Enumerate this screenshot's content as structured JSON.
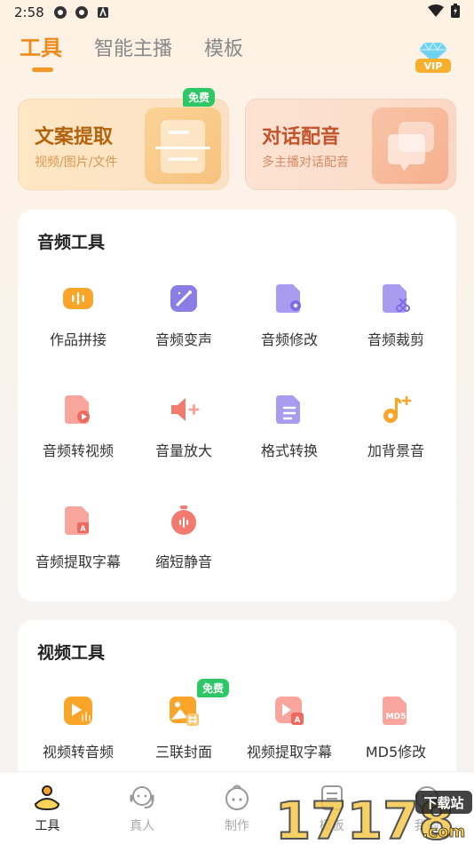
{
  "status_bar": {
    "time": "2:58"
  },
  "top_tabs": [
    {
      "label": "工具",
      "active": true
    },
    {
      "label": "智能主播",
      "active": false
    },
    {
      "label": "模板",
      "active": false
    }
  ],
  "vip_label": "VIP",
  "feature_cards": [
    {
      "title": "文案提取",
      "subtitle": "视频/图片/文件",
      "tag": "免费"
    },
    {
      "title": "对话配音",
      "subtitle": "多主播对话配音"
    }
  ],
  "audio_tools": {
    "title": "音频工具",
    "items": [
      {
        "label": "作品拼接",
        "icon": "waveform-icon",
        "color": "#f8a52a"
      },
      {
        "label": "音频变声",
        "icon": "magic-wand-icon",
        "color": "#8c7de6"
      },
      {
        "label": "音频修改",
        "icon": "file-gear-icon",
        "color": "#8c7de6"
      },
      {
        "label": "音频裁剪",
        "icon": "file-scissors-icon",
        "color": "#8c7de6"
      },
      {
        "label": "音频转视频",
        "icon": "file-play-icon",
        "color": "#f27a6f"
      },
      {
        "label": "音量放大",
        "icon": "speaker-plus-icon",
        "color": "#f27a6f"
      },
      {
        "label": "格式转换",
        "icon": "file-convert-icon",
        "color": "#8c7de6"
      },
      {
        "label": "加背景音",
        "icon": "music-note-plus-icon",
        "color": "#f8a52a"
      },
      {
        "label": "音频提取字幕",
        "icon": "file-subtitle-icon",
        "color": "#f27a6f"
      },
      {
        "label": "缩短静音",
        "icon": "stopwatch-icon",
        "color": "#f27a6f"
      }
    ]
  },
  "video_tools": {
    "title": "视频工具",
    "items": [
      {
        "label": "视频转音频",
        "icon": "video-audio-icon",
        "color": "#f8a52a"
      },
      {
        "label": "三联封面",
        "icon": "image-grid-icon",
        "color": "#f8a52a",
        "tag": "免费"
      },
      {
        "label": "视频提取字幕",
        "icon": "video-subtitle-icon",
        "color": "#f27a6f"
      },
      {
        "label": "MD5修改",
        "icon": "md5-file-icon",
        "color": "#f27a6f",
        "icon_text": "MD5"
      }
    ]
  },
  "bottom_nav": [
    {
      "label": "工具",
      "active": true,
      "icon": "tools-icon"
    },
    {
      "label": "真人",
      "active": false,
      "icon": "headset-person-icon"
    },
    {
      "label": "制作",
      "active": false,
      "icon": "create-face-icon"
    },
    {
      "label": "模板",
      "active": false,
      "icon": "template-icon"
    },
    {
      "label": "我的",
      "active": false,
      "icon": "profile-icon"
    }
  ],
  "watermark": {
    "number": "17178",
    "domain": ".com",
    "badge": "下载站"
  }
}
